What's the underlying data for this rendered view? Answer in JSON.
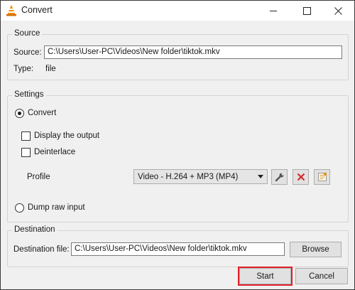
{
  "window": {
    "title": "Convert"
  },
  "source": {
    "group_title": "Source",
    "source_label": "Source:",
    "source_value": "C:\\Users\\User-PC\\Videos\\New folder\\tiktok.mkv",
    "type_label": "Type:",
    "type_value": "file"
  },
  "settings": {
    "group_title": "Settings",
    "convert_label": "Convert",
    "display_output_label": "Display the output",
    "deinterlace_label": "Deinterlace",
    "profile_label": "Profile",
    "profile_value": "Video - H.264 + MP3 (MP4)",
    "dump_raw_label": "Dump raw input"
  },
  "destination": {
    "group_title": "Destination",
    "file_label": "Destination file:",
    "file_value": "C:\\Users\\User-PC\\Videos\\New folder\\tiktok.mkv",
    "browse_label": "Browse"
  },
  "buttons": {
    "start_label": "Start",
    "cancel_label": "Cancel"
  },
  "colors": {
    "highlight": "#e0202a",
    "vlc_orange": "#f08c00",
    "delete_red": "#d42b2b"
  },
  "icons": {
    "app": "vlc-cone-icon",
    "minimize": "minimize-icon",
    "maximize": "maximize-icon",
    "close": "close-icon",
    "edit_profile": "wrench-icon",
    "delete_profile": "delete-x-icon",
    "new_profile": "new-profile-icon",
    "combo_arrow": "chevron-down-icon"
  }
}
